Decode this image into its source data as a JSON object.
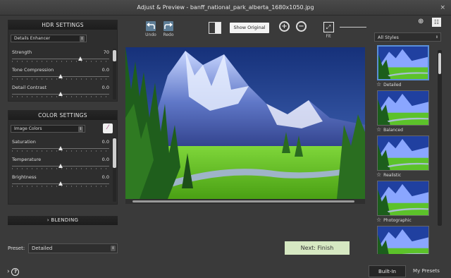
{
  "window": {
    "title": "Adjust & Preview - banff_national_park_alberta_1680x1050.jpg",
    "close": "×"
  },
  "hdr": {
    "title": "HDR SETTINGS",
    "mode": "Details Enhancer",
    "sliders": [
      {
        "label": "Strength",
        "value": "70",
        "level": 0.7
      },
      {
        "label": "Tone Compression",
        "value": "0.0",
        "level": 0.5
      },
      {
        "label": "Detail Contrast",
        "value": "0.0",
        "level": 0.5
      }
    ]
  },
  "color": {
    "title": "COLOR SETTINGS",
    "mode": "Image Colors",
    "sliders": [
      {
        "label": "Saturation",
        "value": "0.0",
        "level": 0.5
      },
      {
        "label": "Temperature",
        "value": "0.0",
        "level": 0.5
      },
      {
        "label": "Brightness",
        "value": "0.0",
        "level": 0.5
      }
    ]
  },
  "blending": {
    "label": "BLENDING",
    "arrow": "›"
  },
  "preset": {
    "label": "Preset:",
    "value": "Detailed"
  },
  "help": {
    "chevron": "›",
    "symbol": "?"
  },
  "toolbar": {
    "undo": "Undo",
    "redo": "Redo",
    "show_original": "Show Original",
    "zoom_in": "+",
    "zoom_out": "−",
    "fit": "Fit"
  },
  "next": {
    "label": "Next: Finish"
  },
  "styles": {
    "filter": "All Styles",
    "items": [
      {
        "label": "Detailed",
        "selected": true
      },
      {
        "label": "Balanced",
        "selected": false
      },
      {
        "label": "Realistic",
        "selected": false
      },
      {
        "label": "Photographic",
        "selected": false
      }
    ],
    "tabs": {
      "builtin": "Built-In",
      "mypresets": "My Presets"
    }
  },
  "colors": {
    "accent": "#5a8fd8",
    "next_bg": "#d6e8c2",
    "panel_header": "#1d1d1d"
  }
}
